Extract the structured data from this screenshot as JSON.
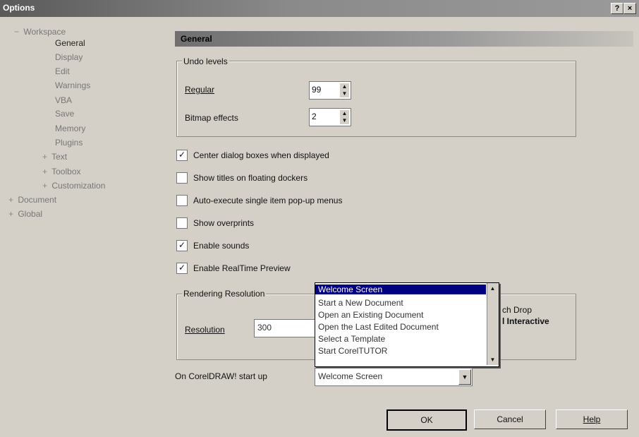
{
  "window": {
    "title": "Options",
    "help_glyph": "?",
    "close_glyph": "×"
  },
  "tree": {
    "items": [
      {
        "label": "Workspace",
        "expander": "−"
      },
      {
        "label": "General",
        "expander": ""
      },
      {
        "label": "Display",
        "expander": ""
      },
      {
        "label": "Edit",
        "expander": ""
      },
      {
        "label": "Warnings",
        "expander": ""
      },
      {
        "label": "VBA",
        "expander": ""
      },
      {
        "label": "Save",
        "expander": ""
      },
      {
        "label": "Memory",
        "expander": ""
      },
      {
        "label": "Plugins",
        "expander": ""
      },
      {
        "label": "Text",
        "expander": "+"
      },
      {
        "label": "Toolbox",
        "expander": "+"
      },
      {
        "label": "Customization",
        "expander": "+"
      },
      {
        "label": "Document",
        "expander": "+"
      },
      {
        "label": "Global",
        "expander": "+"
      }
    ]
  },
  "section": {
    "title": "General"
  },
  "undo": {
    "group_label": "Undo levels",
    "regular_label": "Regular",
    "regular_value": "99",
    "bitmap_label": "Bitmap effects",
    "bitmap_value": "2"
  },
  "checkboxes": [
    {
      "label": "Center dialog boxes when displayed",
      "checked": "✓"
    },
    {
      "label": "Show titles on floating dockers",
      "checked": ""
    },
    {
      "label": "Auto-execute single item pop-up menus",
      "checked": ""
    },
    {
      "label": "Show overprints",
      "checked": ""
    },
    {
      "label": "Enable sounds",
      "checked": "✓"
    },
    {
      "label": "Enable RealTime Preview",
      "checked": "✓"
    }
  ],
  "rendering": {
    "group_label": "Rendering Resolution",
    "resolution_label": "Resolution",
    "resolution_value": "300",
    "right_text_1": "ch Drop",
    "right_text_2": "l Interactive"
  },
  "startup": {
    "label": "On CorelDRAW! start up",
    "value": "Welcome Screen",
    "options": [
      "Welcome Screen",
      "Start a New Document",
      "Open an Existing Document",
      "Open the Last Edited Document",
      "Select a Template",
      "Start CorelTUTOR"
    ]
  },
  "buttons": {
    "ok": "OK",
    "cancel": "Cancel",
    "help": "Help"
  }
}
